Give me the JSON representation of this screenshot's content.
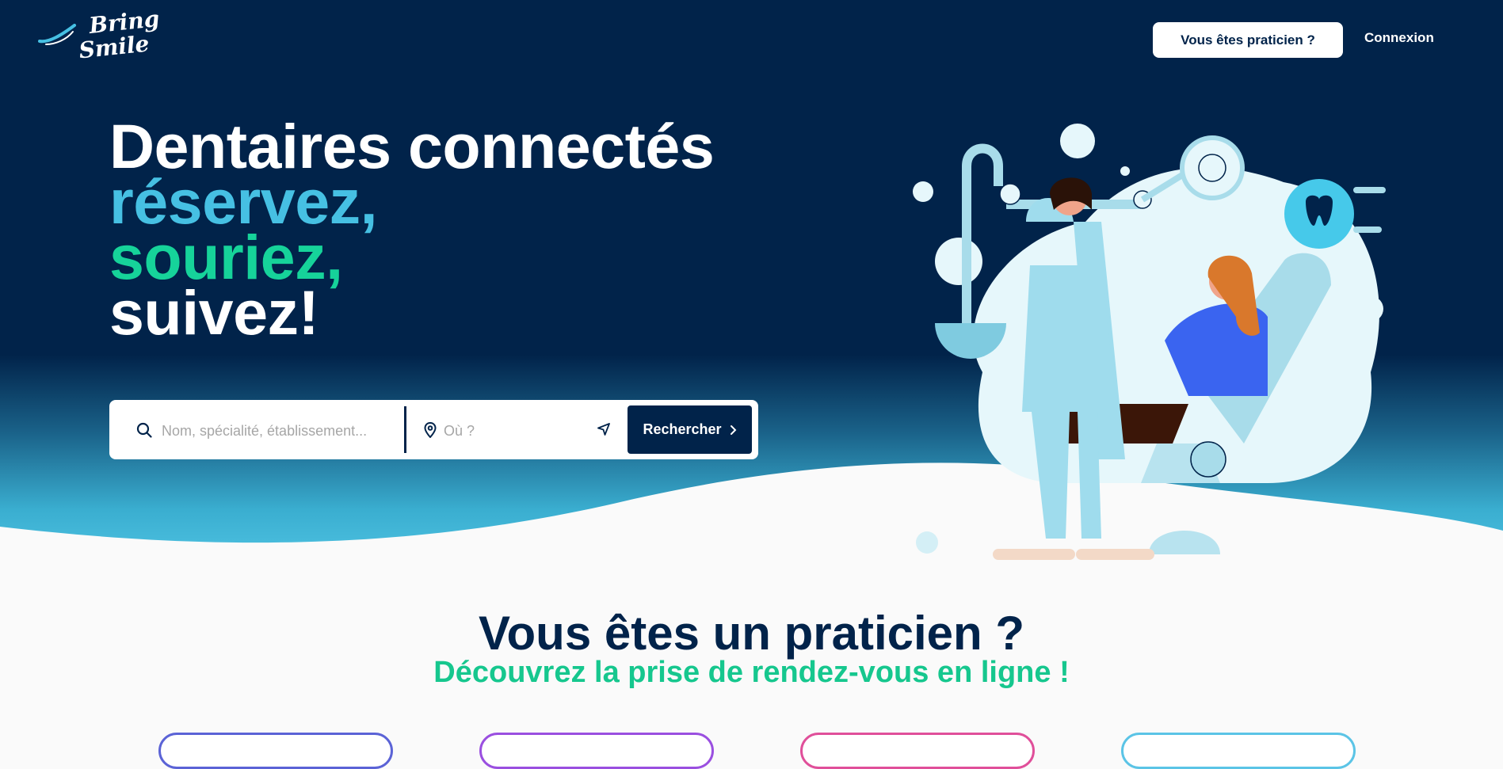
{
  "brand": {
    "name_line1": "Bring",
    "name_line2": "Smile"
  },
  "nav": {
    "practitioner_button": "Vous êtes praticien ?",
    "login_link": "Connexion"
  },
  "hero": {
    "line1": "Dentaires connectés",
    "line2": "réservez,",
    "line3": "souriez,",
    "line4": "suivez!"
  },
  "search": {
    "query_placeholder": "Nom, spécialité, établissement...",
    "location_placeholder": "Où ?",
    "button_label": "Rechercher"
  },
  "section": {
    "title": "Vous êtes un praticien ?",
    "subtitle": "Découvrez la prise de rendez-vous en ligne !"
  },
  "colors": {
    "navy": "#01234a",
    "accent_blue": "#46c0e3",
    "accent_green": "#16d39a",
    "card_borders": [
      "#5b63d6",
      "#9a4fe0",
      "#e04f9a",
      "#5bc4e6"
    ]
  }
}
